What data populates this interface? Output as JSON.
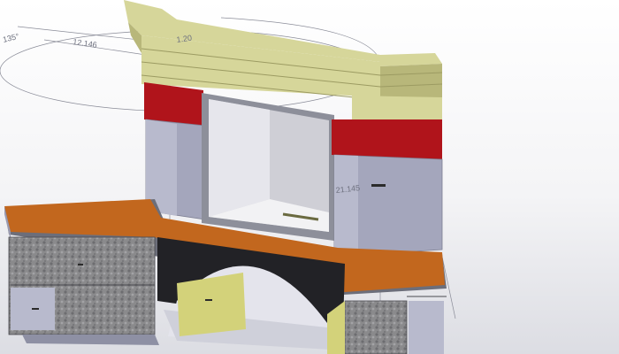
{
  "viewport": {
    "background": "#e6e7ec"
  },
  "dimensions": {
    "angle": "135°",
    "radius": "12.146",
    "width_top": "1.20",
    "pillar": "21.145"
  },
  "model": {
    "colors": {
      "mantel": "#d6d69a",
      "mantel_dark": "#b8b77a",
      "accent_red": "#b0141b",
      "pillar_grey": "#a4a6bc",
      "hearth_orange": "#c2671e",
      "stone": "#8d8d8f",
      "firebox_inner": "#cfcfd6",
      "arch_dark": "#222226",
      "yellow_panel": "#d3d27a"
    }
  }
}
